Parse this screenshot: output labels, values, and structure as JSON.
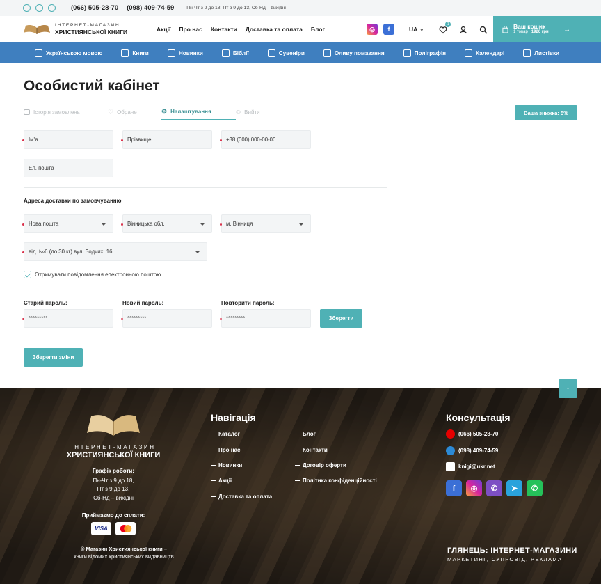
{
  "topbar": {
    "phone1": "(066) 505-28-70",
    "phone2": "(098) 409-74-59",
    "hours": "Пн-Чт з 9 до 18, Пт з 9 до 13, Сб-Нд – вихідні",
    "icons": [
      "telegram-icon",
      "whatsapp-icon",
      "viber-icon"
    ]
  },
  "header": {
    "logo_line1": "ІНТЕРНЕТ-МАГАЗИН",
    "logo_line2": "ХРИСТИЯНСЬКОЇ КНИГИ",
    "nav": [
      "Акції",
      "Про нас",
      "Контакти",
      "Доставка та оплата",
      "Блог"
    ],
    "lang": "UA",
    "wishlist_count": "1",
    "cart": {
      "title": "Ваш кошик",
      "count": "1 товар",
      "total": "1920 грн"
    }
  },
  "categories": [
    "Українською мовою",
    "Книги",
    "Новинки",
    "Біблії",
    "Сувеніри",
    "Оливу помазання",
    "Поліграфія",
    "Календарі",
    "Листівки"
  ],
  "page": {
    "title": "Особистий кабінет",
    "tabs": [
      "Історія замовлень",
      "Обране",
      "Налаштування",
      "Вийти"
    ],
    "discount": "Ваша знижка: 5%"
  },
  "form": {
    "first_name": "Ім'я",
    "last_name": "Прізвище",
    "phone": "+38 (000) 000-00-00",
    "email": "Ел. пошта",
    "delivery_title": "Адреса доставки по замовчуванню",
    "carrier": "Нова пошта",
    "region": "Вінницька обл.",
    "city": "м. Вінниця",
    "branch": "від. №6 (до 30 кг) вул. Зодчих, 16",
    "newsletter": "Отримувати повідомлення електронною поштою",
    "newsletter_checked": true,
    "old_password_label": "Старий пароль:",
    "new_password_label": "Новий пароль:",
    "repeat_password_label": "Повторити пароль:",
    "old_password": "*********",
    "new_password": "*********",
    "repeat_password": "*********",
    "save_password": "Зберегти",
    "save_changes": "Зберегти зміни"
  },
  "footer": {
    "logo_line1": "ІНТЕРНЕТ-МАГАЗИН",
    "logo_line2": "ХРИСТИЯНСЬКОЇ КНИГИ",
    "schedule_title": "Графік роботи:",
    "schedule": [
      "Пн-Чт з 9 до 18,",
      "Пт з 9 до 13,",
      "Сб-Нд – вихідні"
    ],
    "payment_title": "Приймаємо до сплати:",
    "payment": [
      "VISA",
      "MasterCard"
    ],
    "copyright_bold": "© Магазин Християнської книги –",
    "copyright": "книги відомих християнських видавництв",
    "nav_title": "Навігація",
    "nav_col1": [
      "Каталог",
      "Про нас",
      "Новинки",
      "Акції",
      "Доставка та оплата"
    ],
    "nav_col2": [
      "Блог",
      "Контакти",
      "Договір оферти",
      "Політика конфіденційності"
    ],
    "consult_title": "Консультація",
    "contacts": [
      "(066) 505-28-70",
      "(098) 409-74-59",
      "knigi@ukr.net"
    ],
    "developer_line1": "ГЛЯНЕЦЬ: ІНТЕРНЕТ-МАГАЗИНИ",
    "developer_line2": "МАРКЕТИНГ, СУПРОВІД, РЕКЛАМА"
  },
  "colors": {
    "accent": "#4fb1b5",
    "nav_blue": "#3f7fbf",
    "required": "#d9304a"
  }
}
